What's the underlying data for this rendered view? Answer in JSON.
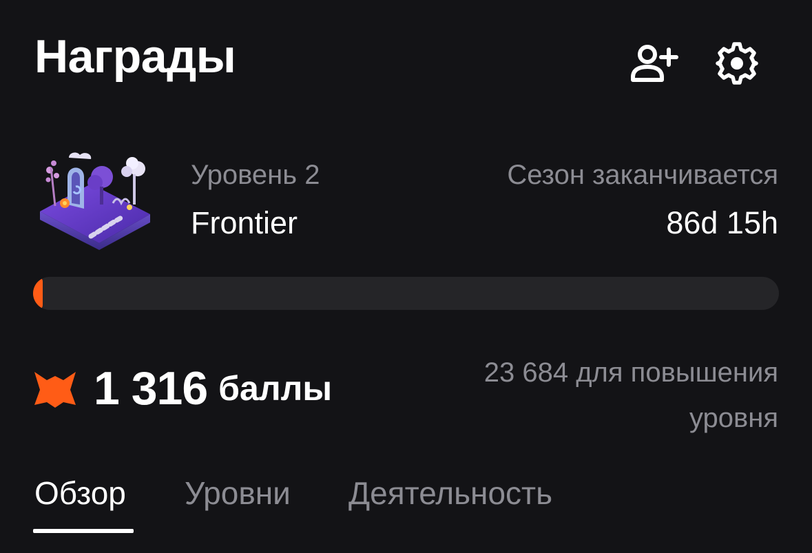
{
  "header": {
    "title": "Награды",
    "add_friend_icon": "person-add-icon",
    "settings_icon": "gear-icon"
  },
  "level": {
    "art_icon": "level-island-illustration",
    "label": "Уровень 2",
    "name": "Frontier"
  },
  "season": {
    "label": "Сезон заканчивается",
    "time_left": "86d 15h"
  },
  "progress": {
    "fraction": 0.013,
    "fill_color": "#ff5c16",
    "track_color": "#252528"
  },
  "points": {
    "icon": "fox-icon",
    "value": "1 316",
    "unit": "баллы",
    "to_next_level": "23 684 для повышения уровня"
  },
  "tabs": [
    {
      "label": "Обзор",
      "active": true
    },
    {
      "label": "Уровни",
      "active": false
    },
    {
      "label": "Деятельность",
      "active": false
    }
  ],
  "colors": {
    "background": "#131316",
    "accent": "#ff5c16",
    "muted_text": "#8c8c93",
    "primary_text": "#ffffff"
  }
}
